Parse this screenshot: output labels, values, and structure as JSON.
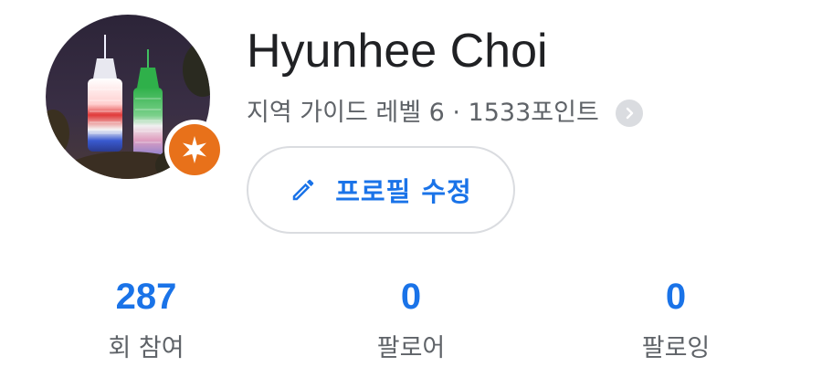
{
  "profile": {
    "name": "Hyunhee Choi",
    "subtitle": "지역 가이드 레벨 6 · 1533포인트",
    "edit_label": "프로필 수정"
  },
  "stats": [
    {
      "value": "287",
      "label": "회 참여"
    },
    {
      "value": "0",
      "label": "팔로어"
    },
    {
      "value": "0",
      "label": "팔로잉"
    }
  ],
  "colors": {
    "accent": "#1a73e8",
    "badge": "#e8711a",
    "text_primary": "#202124",
    "text_secondary": "#5f6368"
  },
  "icons": {
    "badge": "local-guide-star-icon",
    "edit": "pencil-icon",
    "chevron": "chevron-right-icon"
  }
}
